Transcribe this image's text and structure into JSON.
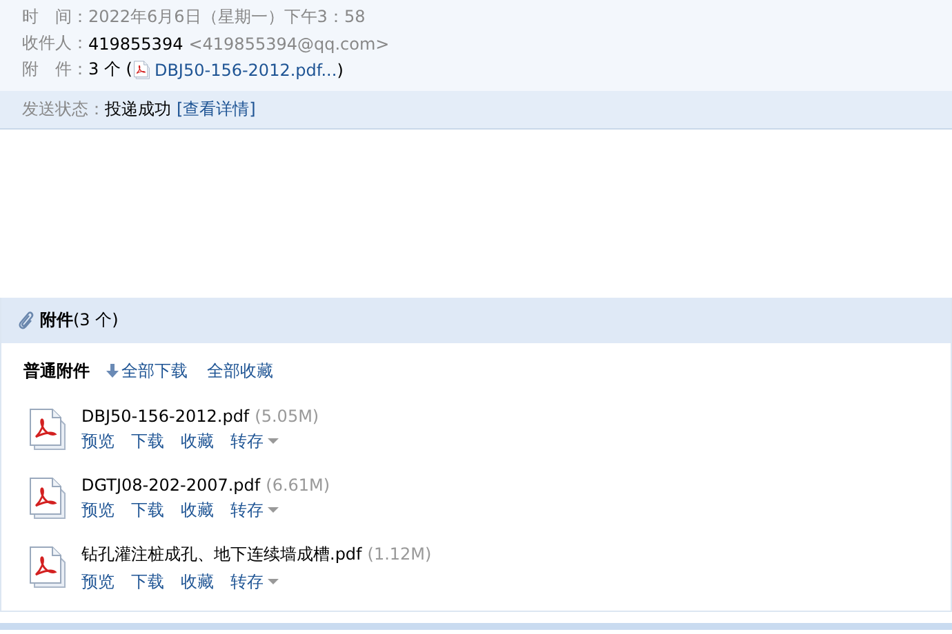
{
  "header": {
    "time": {
      "label": "时　间：",
      "value": "2022年6月6日（星期一）下午3：58"
    },
    "recipient": {
      "label": "收件人：",
      "name": "419855394",
      "address": "<419855394@qq.com>"
    },
    "attachment_summary": {
      "label": "附　件：",
      "count": "3 个 (",
      "link": "DBJ50-156-2012.pdf...",
      "close": ")"
    }
  },
  "status": {
    "label": "发送状态：",
    "value": "投递成功",
    "link": "[查看详情]"
  },
  "attachments": {
    "title": "附件",
    "count": "(3 个)",
    "section_label": "普通附件",
    "actions": [
      {
        "label": "全部下载",
        "kind": "download"
      },
      {
        "label": "全部收藏",
        "kind": "plain"
      }
    ],
    "files": [
      {
        "name": "DBJ50-156-2012.pdf",
        "size": "(5.05M)",
        "actions": [
          {
            "label": "预览",
            "kind": "plain"
          },
          {
            "label": "下载",
            "kind": "plain"
          },
          {
            "label": "收藏",
            "kind": "plain"
          },
          {
            "label": "转存",
            "kind": "menu"
          }
        ]
      },
      {
        "name": "DGTJ08-202-2007.pdf",
        "size": "(6.61M)",
        "actions": [
          {
            "label": "预览",
            "kind": "plain"
          },
          {
            "label": "下载",
            "kind": "plain"
          },
          {
            "label": "收藏",
            "kind": "plain"
          },
          {
            "label": "转存",
            "kind": "menu"
          }
        ]
      },
      {
        "name": "钻孔灌注桩成孔、地下连续墙成槽.pdf",
        "size": "(1.12M)",
        "actions": [
          {
            "label": "预览",
            "kind": "plain"
          },
          {
            "label": "下载",
            "kind": "plain"
          },
          {
            "label": "收藏",
            "kind": "plain"
          },
          {
            "label": "转存",
            "kind": "menu"
          }
        ]
      }
    ]
  }
}
